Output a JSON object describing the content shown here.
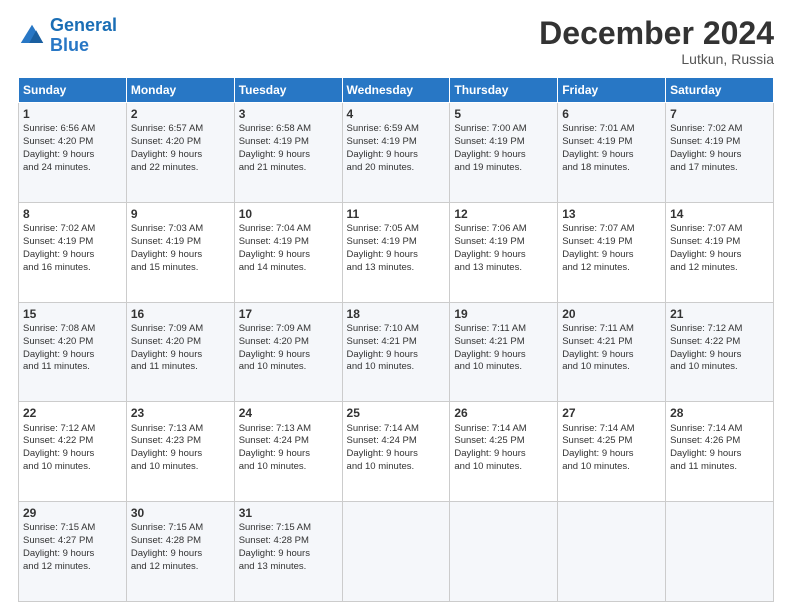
{
  "logo": {
    "line1": "General",
    "line2": "Blue"
  },
  "title": "December 2024",
  "location": "Lutkun, Russia",
  "days_header": [
    "Sunday",
    "Monday",
    "Tuesday",
    "Wednesday",
    "Thursday",
    "Friday",
    "Saturday"
  ],
  "weeks": [
    [
      {
        "day": "1",
        "info": "Sunrise: 6:56 AM\nSunset: 4:20 PM\nDaylight: 9 hours\nand 24 minutes."
      },
      {
        "day": "2",
        "info": "Sunrise: 6:57 AM\nSunset: 4:20 PM\nDaylight: 9 hours\nand 22 minutes."
      },
      {
        "day": "3",
        "info": "Sunrise: 6:58 AM\nSunset: 4:19 PM\nDaylight: 9 hours\nand 21 minutes."
      },
      {
        "day": "4",
        "info": "Sunrise: 6:59 AM\nSunset: 4:19 PM\nDaylight: 9 hours\nand 20 minutes."
      },
      {
        "day": "5",
        "info": "Sunrise: 7:00 AM\nSunset: 4:19 PM\nDaylight: 9 hours\nand 19 minutes."
      },
      {
        "day": "6",
        "info": "Sunrise: 7:01 AM\nSunset: 4:19 PM\nDaylight: 9 hours\nand 18 minutes."
      },
      {
        "day": "7",
        "info": "Sunrise: 7:02 AM\nSunset: 4:19 PM\nDaylight: 9 hours\nand 17 minutes."
      }
    ],
    [
      {
        "day": "8",
        "info": "Sunrise: 7:02 AM\nSunset: 4:19 PM\nDaylight: 9 hours\nand 16 minutes."
      },
      {
        "day": "9",
        "info": "Sunrise: 7:03 AM\nSunset: 4:19 PM\nDaylight: 9 hours\nand 15 minutes."
      },
      {
        "day": "10",
        "info": "Sunrise: 7:04 AM\nSunset: 4:19 PM\nDaylight: 9 hours\nand 14 minutes."
      },
      {
        "day": "11",
        "info": "Sunrise: 7:05 AM\nSunset: 4:19 PM\nDaylight: 9 hours\nand 13 minutes."
      },
      {
        "day": "12",
        "info": "Sunrise: 7:06 AM\nSunset: 4:19 PM\nDaylight: 9 hours\nand 13 minutes."
      },
      {
        "day": "13",
        "info": "Sunrise: 7:07 AM\nSunset: 4:19 PM\nDaylight: 9 hours\nand 12 minutes."
      },
      {
        "day": "14",
        "info": "Sunrise: 7:07 AM\nSunset: 4:19 PM\nDaylight: 9 hours\nand 12 minutes."
      }
    ],
    [
      {
        "day": "15",
        "info": "Sunrise: 7:08 AM\nSunset: 4:20 PM\nDaylight: 9 hours\nand 11 minutes."
      },
      {
        "day": "16",
        "info": "Sunrise: 7:09 AM\nSunset: 4:20 PM\nDaylight: 9 hours\nand 11 minutes."
      },
      {
        "day": "17",
        "info": "Sunrise: 7:09 AM\nSunset: 4:20 PM\nDaylight: 9 hours\nand 10 minutes."
      },
      {
        "day": "18",
        "info": "Sunrise: 7:10 AM\nSunset: 4:21 PM\nDaylight: 9 hours\nand 10 minutes."
      },
      {
        "day": "19",
        "info": "Sunrise: 7:11 AM\nSunset: 4:21 PM\nDaylight: 9 hours\nand 10 minutes."
      },
      {
        "day": "20",
        "info": "Sunrise: 7:11 AM\nSunset: 4:21 PM\nDaylight: 9 hours\nand 10 minutes."
      },
      {
        "day": "21",
        "info": "Sunrise: 7:12 AM\nSunset: 4:22 PM\nDaylight: 9 hours\nand 10 minutes."
      }
    ],
    [
      {
        "day": "22",
        "info": "Sunrise: 7:12 AM\nSunset: 4:22 PM\nDaylight: 9 hours\nand 10 minutes."
      },
      {
        "day": "23",
        "info": "Sunrise: 7:13 AM\nSunset: 4:23 PM\nDaylight: 9 hours\nand 10 minutes."
      },
      {
        "day": "24",
        "info": "Sunrise: 7:13 AM\nSunset: 4:24 PM\nDaylight: 9 hours\nand 10 minutes."
      },
      {
        "day": "25",
        "info": "Sunrise: 7:14 AM\nSunset: 4:24 PM\nDaylight: 9 hours\nand 10 minutes."
      },
      {
        "day": "26",
        "info": "Sunrise: 7:14 AM\nSunset: 4:25 PM\nDaylight: 9 hours\nand 10 minutes."
      },
      {
        "day": "27",
        "info": "Sunrise: 7:14 AM\nSunset: 4:25 PM\nDaylight: 9 hours\nand 10 minutes."
      },
      {
        "day": "28",
        "info": "Sunrise: 7:14 AM\nSunset: 4:26 PM\nDaylight: 9 hours\nand 11 minutes."
      }
    ],
    [
      {
        "day": "29",
        "info": "Sunrise: 7:15 AM\nSunset: 4:27 PM\nDaylight: 9 hours\nand 12 minutes."
      },
      {
        "day": "30",
        "info": "Sunrise: 7:15 AM\nSunset: 4:28 PM\nDaylight: 9 hours\nand 12 minutes."
      },
      {
        "day": "31",
        "info": "Sunrise: 7:15 AM\nSunset: 4:28 PM\nDaylight: 9 hours\nand 13 minutes."
      },
      null,
      null,
      null,
      null
    ]
  ]
}
